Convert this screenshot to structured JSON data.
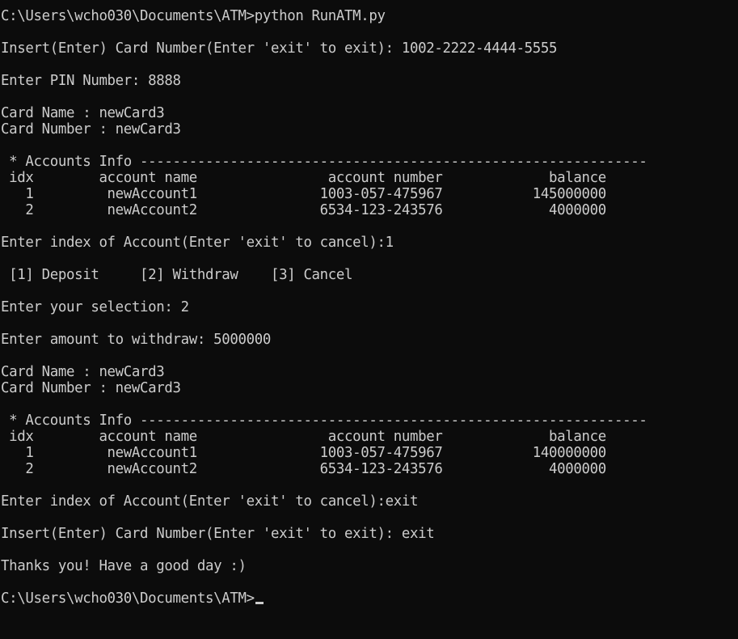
{
  "terminal": {
    "lines": [
      "C:\\Users\\wcho030\\Documents\\ATM>python RunATM.py",
      "",
      "Insert(Enter) Card Number(Enter 'exit' to exit): 1002-2222-4444-5555",
      "",
      "Enter PIN Number: 8888",
      "",
      "Card Name : newCard3",
      "Card Number : newCard3",
      "",
      " * Accounts Info --------------------------------------------------------------",
      " idx        account name                account number             balance",
      "   1         newAccount1               1003-057-475967           145000000",
      "   2         newAccount2               6534-123-243576             4000000",
      "",
      "Enter index of Account(Enter 'exit' to cancel):1",
      "",
      " [1] Deposit     [2] Withdraw    [3] Cancel",
      "",
      "Enter your selection: 2",
      "",
      "Enter amount to withdraw: 5000000",
      "",
      "Card Name : newCard3",
      "Card Number : newCard3",
      "",
      " * Accounts Info --------------------------------------------------------------",
      " idx        account name                account number             balance",
      "   1         newAccount1               1003-057-475967           140000000",
      "   2         newAccount2               6534-123-243576             4000000",
      "",
      "Enter index of Account(Enter 'exit' to cancel):exit",
      "",
      "Insert(Enter) Card Number(Enter 'exit' to exit): exit",
      "",
      "Thanks you! Have a good day :)",
      "",
      "C:\\Users\\wcho030\\Documents\\ATM>"
    ]
  },
  "colors": {
    "background": "#0c0c0c",
    "foreground": "#cccccc"
  }
}
